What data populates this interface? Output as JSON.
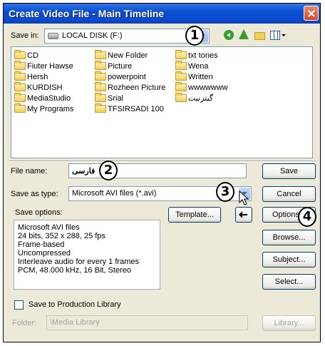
{
  "window": {
    "title": "Create Video File - Main Timeline"
  },
  "save_in": {
    "label": "Save in:",
    "value": "LOCAL DISK (F:)"
  },
  "folders": [
    "CD",
    "Fiuter Hawse",
    "Hersh",
    "KURDISH",
    "MediaStudio",
    "My Programs",
    "New Folder",
    "Picture",
    "powerpoint",
    "Rozheen Picture",
    "Srial",
    "TFSIRSADI 100",
    "txt tones",
    "Wena",
    "Written",
    "wwwwwww",
    "گیتزنیت"
  ],
  "file_name": {
    "label": "File name:",
    "value": "فارسی"
  },
  "save_as_type": {
    "label": "Save as type:",
    "value": "Microsoft AVI files (*.avi)"
  },
  "save_options": {
    "label": "Save options:",
    "lines": [
      "Microsoft AVI files",
      "24 bits, 352 x 288, 25 fps",
      "Frame-based",
      "Uncompressed",
      "Interleave audio for every 1 frames",
      "PCM, 48.000 kHz, 16 Bit, Stereo"
    ]
  },
  "buttons": {
    "save": "Save",
    "cancel": "Cancel",
    "template": "Template...",
    "options": "Options...",
    "browse": "Browse...",
    "subject": "Subject...",
    "select": "Select...",
    "library": "Library..."
  },
  "production_library": {
    "label": "Save to Production Library",
    "checked": false
  },
  "folder_field": {
    "label": "Folder:",
    "value": "\\Media Library"
  },
  "markers": [
    "1",
    "2",
    "3",
    "4"
  ]
}
